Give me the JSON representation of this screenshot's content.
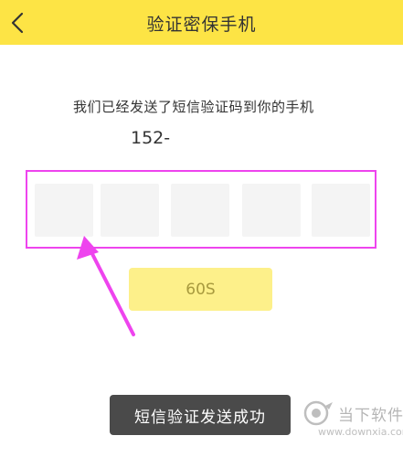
{
  "header": {
    "title": "验证密保手机",
    "back_icon": "chevron-left-icon"
  },
  "verification": {
    "info_text": "我们已经发送了短信验证码到你的手机",
    "phone": "152-",
    "code_box_count": 5,
    "code_values": [
      "",
      "",
      "",
      "",
      ""
    ]
  },
  "countdown": {
    "label": "60S"
  },
  "toast": {
    "message": "短信验证发送成功"
  },
  "watermark": {
    "name": "当下软件园",
    "url": "www.downxia.com"
  },
  "colors": {
    "header_bg": "#fde445",
    "highlight": "#ee44ee",
    "countdown_bg": "#fdf08a",
    "toast_bg": "#4a4a4a"
  }
}
